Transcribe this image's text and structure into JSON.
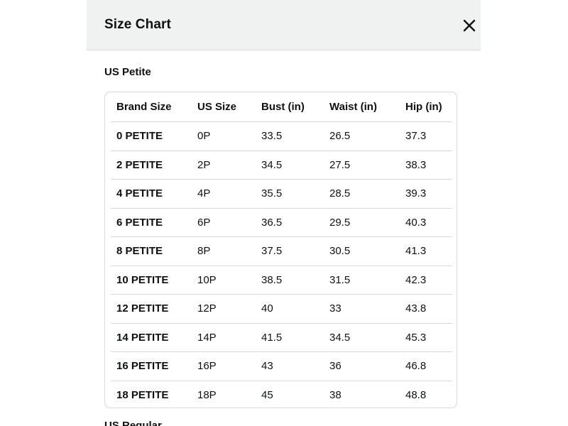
{
  "dialog": {
    "title": "Size Chart",
    "close_icon": "close-icon"
  },
  "section": {
    "title": "US Petite",
    "next_title": "US Regular"
  },
  "table": {
    "headers": [
      "Brand Size",
      "US Size",
      "Bust (in)",
      "Waist (in)",
      "Hip (in)"
    ],
    "rows": [
      [
        "0 PETITE",
        "0P",
        "33.5",
        "26.5",
        "37.3"
      ],
      [
        "2 PETITE",
        "2P",
        "34.5",
        "27.5",
        "38.3"
      ],
      [
        "4 PETITE",
        "4P",
        "35.5",
        "28.5",
        "39.3"
      ],
      [
        "6 PETITE",
        "6P",
        "36.5",
        "29.5",
        "40.3"
      ],
      [
        "8 PETITE",
        "8P",
        "37.5",
        "30.5",
        "41.3"
      ],
      [
        "10 PETITE",
        "10P",
        "38.5",
        "31.5",
        "42.3"
      ],
      [
        "12 PETITE",
        "12P",
        "40",
        "33",
        "43.8"
      ],
      [
        "14 PETITE",
        "14P",
        "41.5",
        "34.5",
        "45.3"
      ],
      [
        "16 PETITE",
        "16P",
        "43",
        "36",
        "46.8"
      ],
      [
        "18 PETITE",
        "18P",
        "45",
        "38",
        "48.8"
      ]
    ]
  },
  "colors": {
    "header_bg": "#f0f2f2",
    "border": "#d5d9d9",
    "text": "#0f1111"
  }
}
